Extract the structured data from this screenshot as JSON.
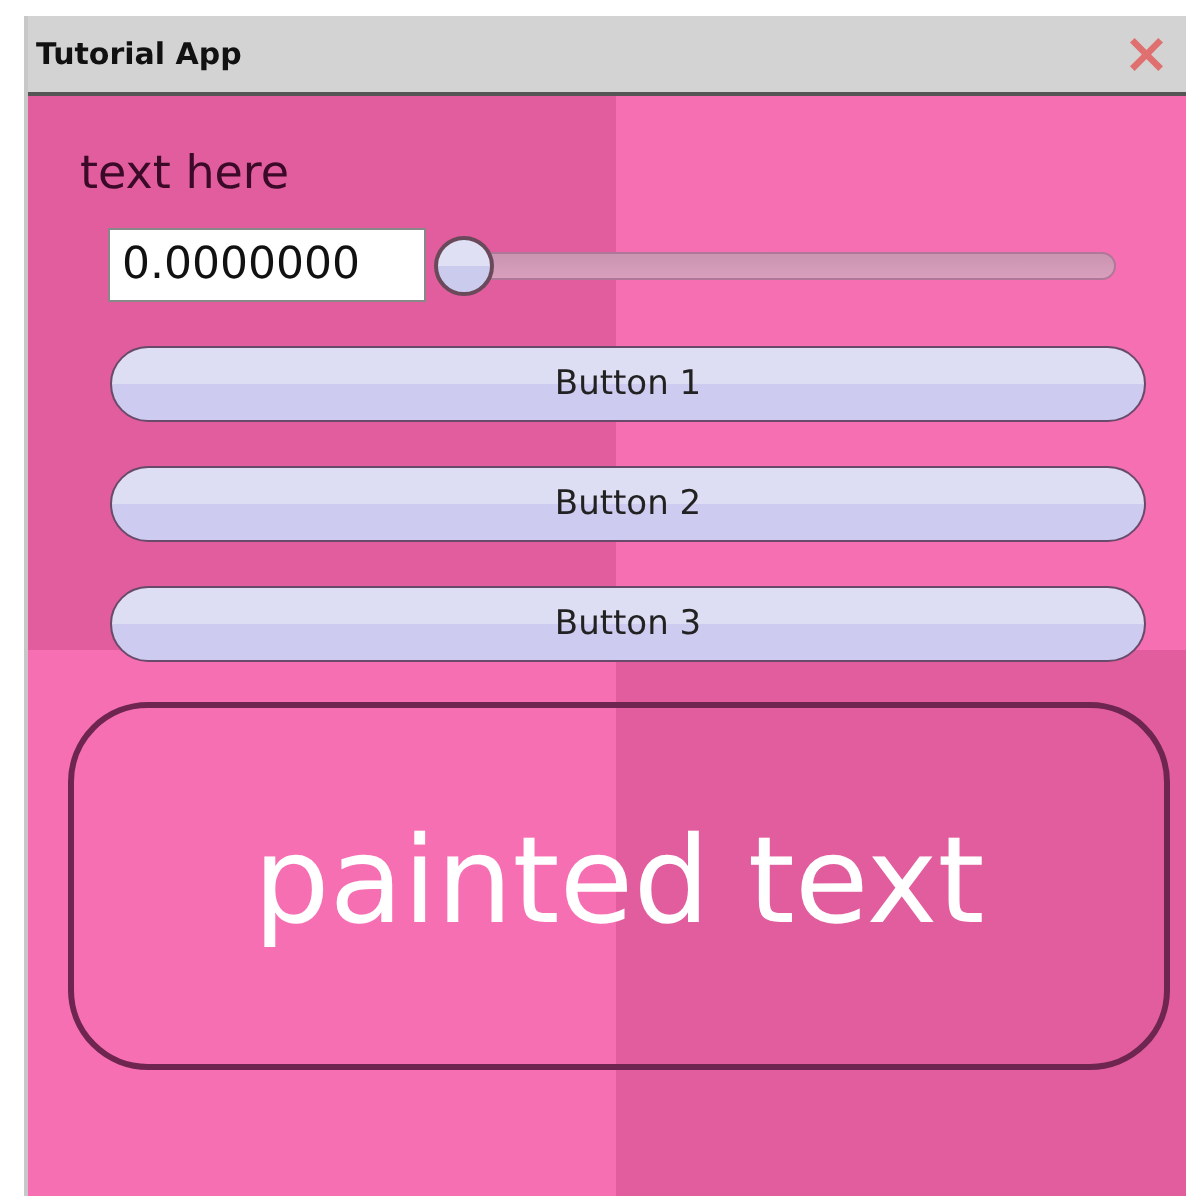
{
  "window": {
    "title": "Tutorial App",
    "close": "×"
  },
  "label": "text here",
  "value_field": {
    "value": "0.0000000"
  },
  "slider": {
    "level": 0
  },
  "buttons": [
    {
      "label": "Button 1"
    },
    {
      "label": "Button 2"
    },
    {
      "label": "Button 3"
    }
  ],
  "painted_text": "painted text"
}
